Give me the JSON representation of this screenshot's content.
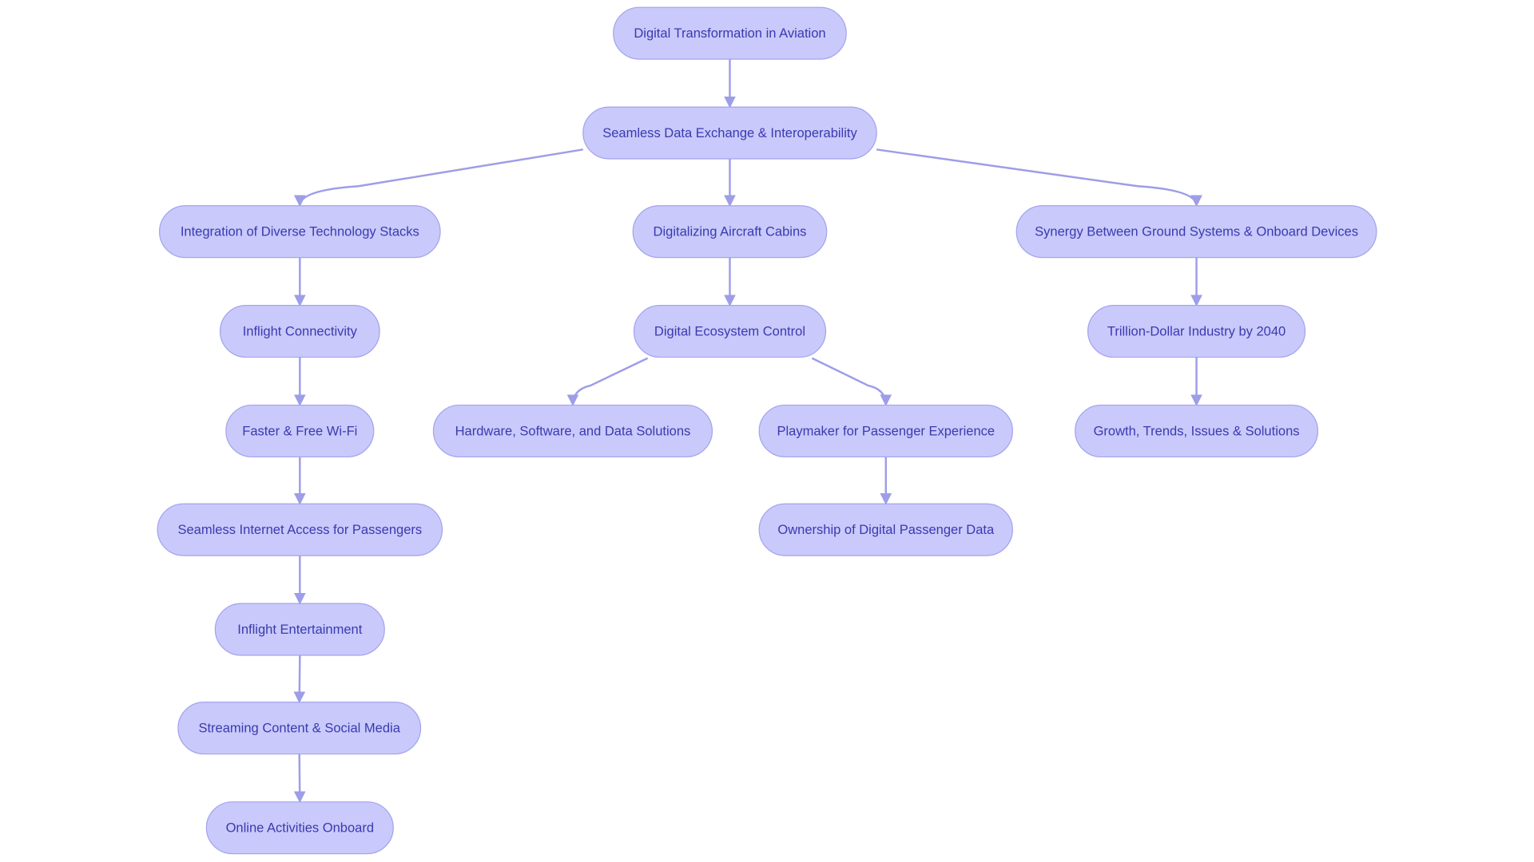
{
  "colors": {
    "node_fill": "#c9c9fb",
    "node_stroke": "#a3a3ee",
    "text": "#3a3ab0",
    "edge": "#9d9de8"
  },
  "nodes": [
    {
      "id": "root",
      "label": "Digital Transformation in Aviation"
    },
    {
      "id": "exchange",
      "label": "Seamless Data Exchange & Interoperability"
    },
    {
      "id": "integration",
      "label": "Integration of Diverse Technology Stacks"
    },
    {
      "id": "cabins",
      "label": "Digitalizing Aircraft Cabins"
    },
    {
      "id": "synergy",
      "label": "Synergy Between Ground Systems & Onboard Devices"
    },
    {
      "id": "connectivity",
      "label": "Inflight Connectivity"
    },
    {
      "id": "ecosystem",
      "label": "Digital Ecosystem Control"
    },
    {
      "id": "trillion",
      "label": "Trillion-Dollar Industry by 2040"
    },
    {
      "id": "wifi",
      "label": "Faster & Free Wi-Fi"
    },
    {
      "id": "hardware",
      "label": "Hardware, Software, and Data Solutions"
    },
    {
      "id": "playmaker",
      "label": "Playmaker for Passenger Experience"
    },
    {
      "id": "growth",
      "label": "Growth, Trends, Issues & Solutions"
    },
    {
      "id": "internet",
      "label": "Seamless Internet Access for Passengers"
    },
    {
      "id": "ownership",
      "label": "Ownership of Digital Passenger Data"
    },
    {
      "id": "entertainment",
      "label": "Inflight Entertainment"
    },
    {
      "id": "streaming",
      "label": "Streaming Content & Social Media"
    },
    {
      "id": "online",
      "label": "Online Activities Onboard"
    }
  ],
  "edges": [
    [
      "root",
      "exchange"
    ],
    [
      "exchange",
      "integration"
    ],
    [
      "exchange",
      "cabins"
    ],
    [
      "exchange",
      "synergy"
    ],
    [
      "integration",
      "connectivity"
    ],
    [
      "cabins",
      "ecosystem"
    ],
    [
      "synergy",
      "trillion"
    ],
    [
      "connectivity",
      "wifi"
    ],
    [
      "ecosystem",
      "hardware"
    ],
    [
      "ecosystem",
      "playmaker"
    ],
    [
      "trillion",
      "growth"
    ],
    [
      "wifi",
      "internet"
    ],
    [
      "playmaker",
      "ownership"
    ],
    [
      "internet",
      "entertainment"
    ],
    [
      "entertainment",
      "streaming"
    ],
    [
      "streaming",
      "online"
    ]
  ]
}
